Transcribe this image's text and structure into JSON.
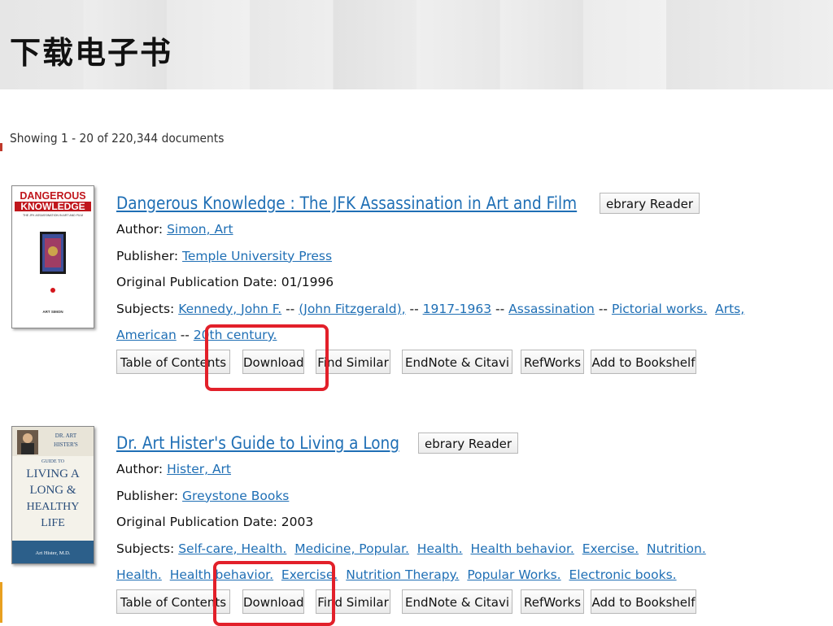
{
  "header": {
    "title": "下载电子书"
  },
  "results": {
    "summary": "Showing 1 - 20 of 220,344 documents"
  },
  "records": [
    {
      "title": "Dangerous Knowledge : The JFK Assassination in Art and Film",
      "reader_button": "ebrary Reader",
      "author_label": "Author:",
      "author": "Simon, Art",
      "publisher_label": "Publisher:",
      "publisher": "Temple University Press",
      "pubdate_label": "Original Publication Date:",
      "pubdate": "01/1996",
      "subjects_label": "Subjects:",
      "subjects_line1": [
        {
          "text": "Kennedy, John F.",
          "sep": " -- "
        },
        {
          "text": "(John Fitzgerald),",
          "sep": " -- "
        },
        {
          "text": "1917-1963",
          "sep": " -- "
        },
        {
          "text": "Assassination",
          "sep": " -- "
        },
        {
          "text": "Pictorial works.",
          "sep": "  "
        },
        {
          "text": "Arts,",
          "sep": ""
        }
      ],
      "subjects_line2": [
        {
          "text": "American",
          "sep": " -- "
        },
        {
          "text": "20th century.",
          "sep": ""
        }
      ],
      "cover": {
        "title_top": "DANGEROUS",
        "title_bottom": "KNOWLEDGE",
        "subtitle": "THE JFK ASSASSINATION IN ART AND FILM",
        "author": "ART SIMON"
      },
      "actions": [
        "Table of Contents",
        "Download",
        "Find Similar",
        "EndNote & Citavi",
        "RefWorks",
        "Add to Bookshelf"
      ]
    },
    {
      "title": "Dr. Art Hister's Guide to Living a Long",
      "reader_button": "ebrary Reader",
      "author_label": "Author:",
      "author": "Hister, Art",
      "publisher_label": "Publisher:",
      "publisher": "Greystone Books",
      "pubdate_label": "Original Publication Date:",
      "pubdate": "2003",
      "subjects_label": "Subjects:",
      "subjects_line1": [
        {
          "text": "Self-care, Health.",
          "sep": "  "
        },
        {
          "text": "Medicine, Popular.",
          "sep": "  "
        },
        {
          "text": "Health.",
          "sep": "  "
        },
        {
          "text": "Health behavior.",
          "sep": "  "
        },
        {
          "text": "Exercise.",
          "sep": "  "
        },
        {
          "text": "Nutrition.",
          "sep": ""
        }
      ],
      "subjects_line2": [
        {
          "text": "Health.",
          "sep": "  "
        },
        {
          "text": "Health behavior.",
          "sep": "  "
        },
        {
          "text": "Exercise.",
          "sep": "  "
        },
        {
          "text": "Nutrition Therapy.",
          "sep": "  "
        },
        {
          "text": "Popular Works.",
          "sep": "  "
        },
        {
          "text": "Electronic books.",
          "sep": ""
        }
      ],
      "cover": {
        "line1": "DR. ART",
        "line2": "HISTER'S",
        "line3": "GUIDE TO",
        "line4": "LIVING A",
        "line5": "LONG &",
        "line6": "HEALTHY",
        "line7": "LIFE",
        "author": "Art Hister, M.D."
      },
      "actions": [
        "Table of Contents",
        "Download",
        "Find Similar",
        "EndNote & Citavi",
        "RefWorks",
        "Add to Bookshelf"
      ]
    }
  ],
  "colors": {
    "link": "#1f6fb5",
    "highlight": "#e2202a",
    "header_bg": "#e9e9e9"
  }
}
